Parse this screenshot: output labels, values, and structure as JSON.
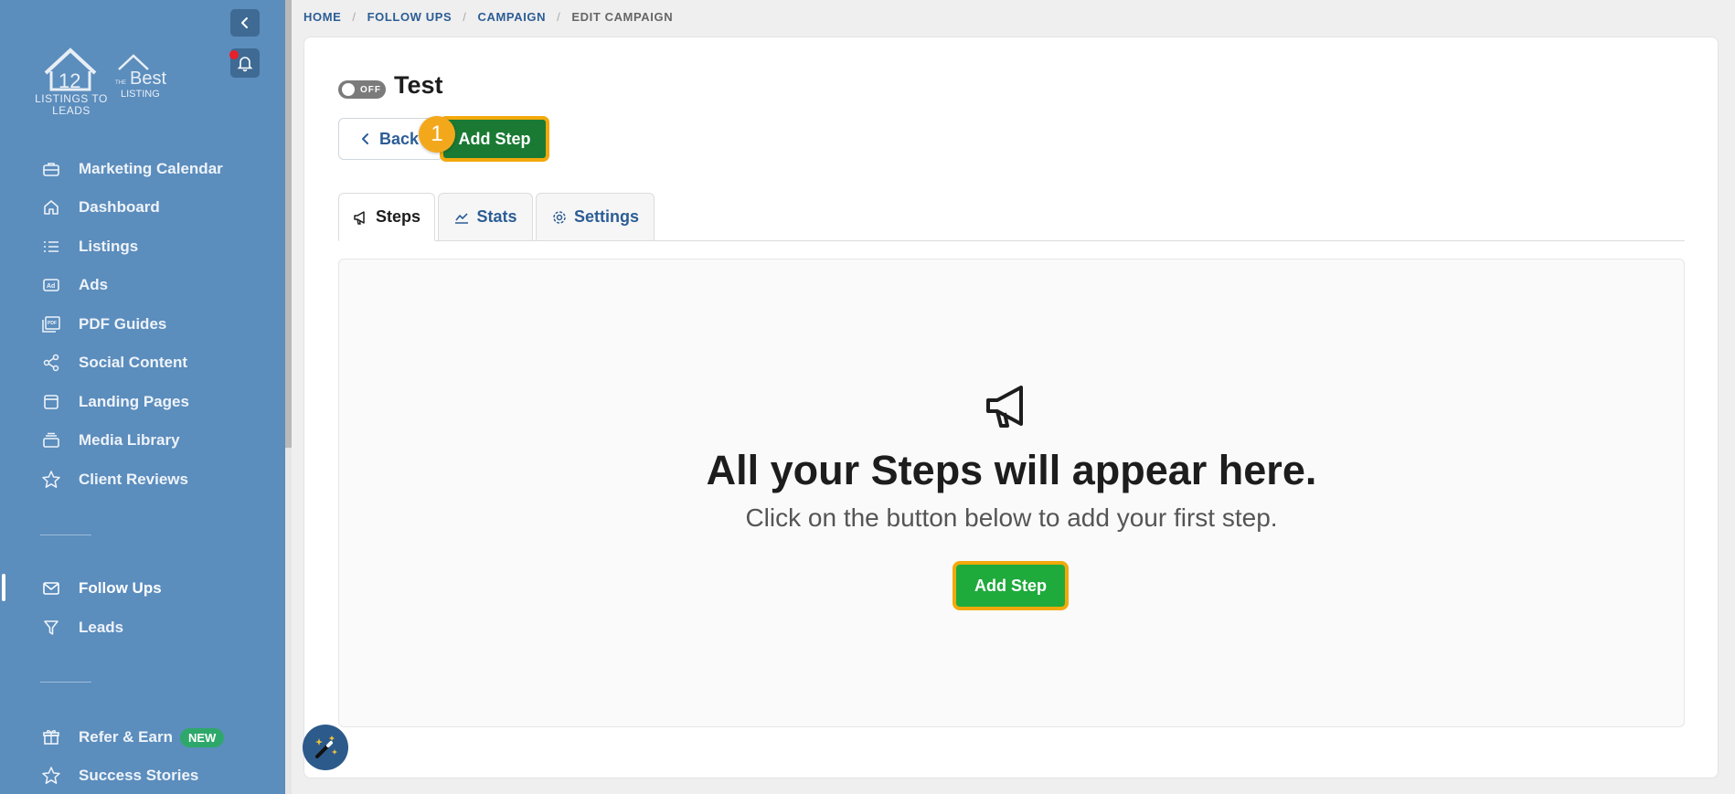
{
  "sidebar": {
    "logo_primary_text": "LISTINGS TO LEADS",
    "logo_secondary_text": "THE Best LISTING",
    "items": [
      {
        "label": "Marketing Calendar",
        "icon": "briefcase-icon"
      },
      {
        "label": "Dashboard",
        "icon": "home-icon"
      },
      {
        "label": "Listings",
        "icon": "list-icon"
      },
      {
        "label": "Ads",
        "icon": "ad-icon"
      },
      {
        "label": "PDF Guides",
        "icon": "pdf-icon"
      },
      {
        "label": "Social Content",
        "icon": "share-icon"
      },
      {
        "label": "Landing Pages",
        "icon": "browser-icon"
      },
      {
        "label": "Media Library",
        "icon": "stack-icon"
      },
      {
        "label": "Client Reviews",
        "icon": "star-icon"
      }
    ],
    "secondary_items": [
      {
        "label": "Follow Ups",
        "icon": "mail-icon",
        "active": true
      },
      {
        "label": "Leads",
        "icon": "funnel-icon"
      }
    ],
    "bottom_items": [
      {
        "label": "Refer & Earn",
        "icon": "gift-icon",
        "badge": "NEW"
      },
      {
        "label": "Success Stories",
        "icon": "star-icon"
      }
    ]
  },
  "breadcrumb": [
    "HOME",
    "FOLLOW UPS",
    "CAMPAIGN",
    "EDIT CAMPAIGN"
  ],
  "campaign": {
    "toggle_label": "OFF",
    "title": "Test"
  },
  "actions": {
    "back_label": "Back",
    "add_step_label": "Add Step",
    "step_badge": "1"
  },
  "tabs": [
    {
      "label": "Steps",
      "icon": "megaphone-icon",
      "active": true
    },
    {
      "label": "Stats",
      "icon": "chart-line-icon"
    },
    {
      "label": "Settings",
      "icon": "gear-icon"
    }
  ],
  "empty_state": {
    "icon": "megaphone-icon",
    "title": "All your Steps will appear here.",
    "subtitle": "Click on the button below to add your first step.",
    "button_label": "Add Step"
  },
  "colors": {
    "sidebar": "#5b8dbd",
    "primary_green": "#1a7a34",
    "highlight": "#f2a90b",
    "link_blue": "#2c5d95"
  }
}
